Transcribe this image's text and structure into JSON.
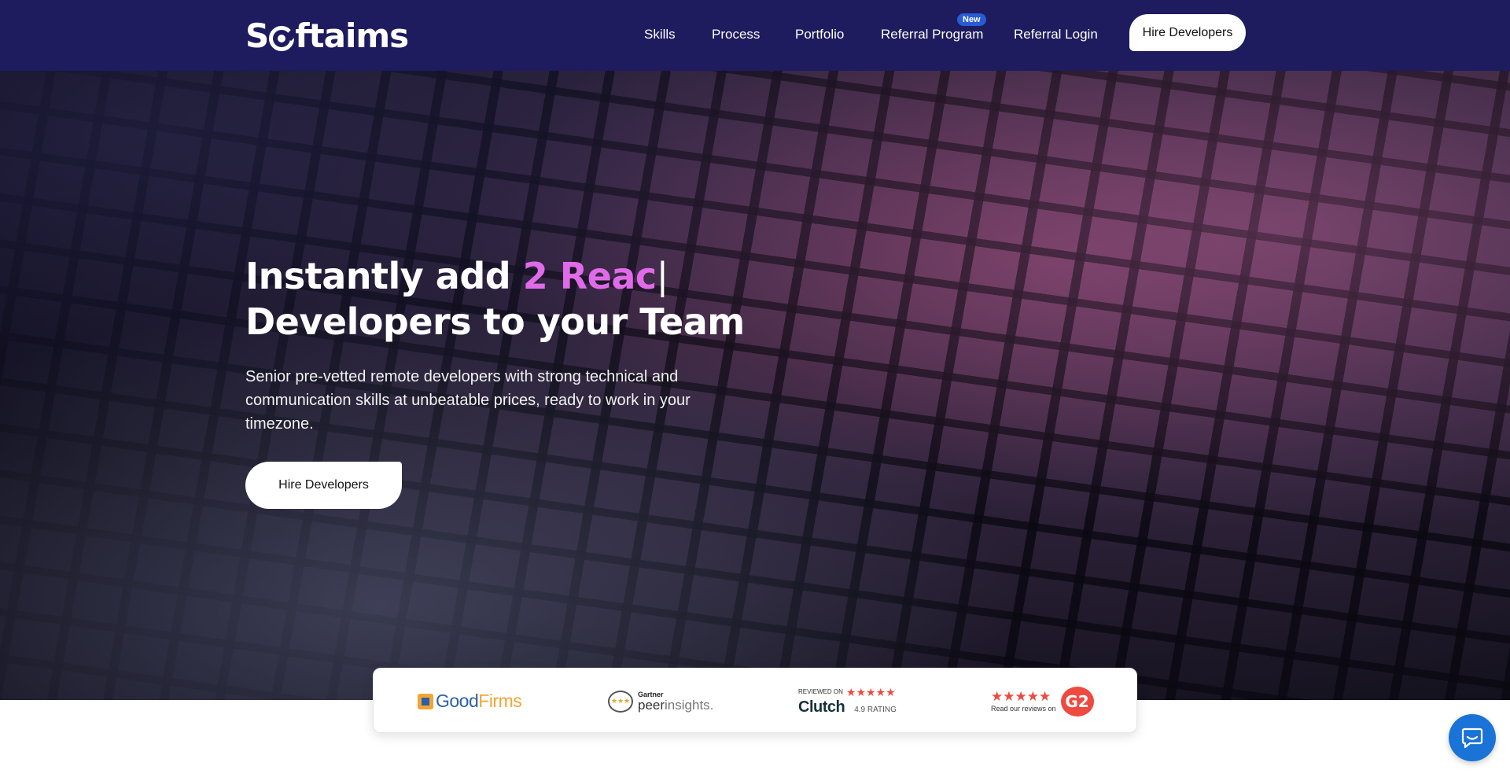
{
  "header": {
    "logo_text": "Softaims",
    "logo_pre": "S",
    "logo_post": "ftaims",
    "nav": [
      {
        "label": "Skills"
      },
      {
        "label": "Process"
      },
      {
        "label": "Portfolio"
      },
      {
        "label": "Referral Program"
      },
      {
        "label": "Referral Login"
      }
    ],
    "new_badge": "New",
    "cta_label": "Hire Developers"
  },
  "hero": {
    "headline_prefix": "Instantly add ",
    "headline_accent": "2 Reac",
    "headline_cursor": "|",
    "headline_line2": "Developers to your Team",
    "subtext": "Senior pre-vetted remote developers with strong technical and communication skills at unbeatable prices, ready to work in your timezone.",
    "cta_label": "Hire Developers"
  },
  "reviews": {
    "goodfirms": {
      "good": "Good",
      "firms": "Firms"
    },
    "gartner": {
      "small": "Gartner",
      "peer": "peer",
      "insights": "insights."
    },
    "clutch": {
      "reviewed_on": "REVIEWED ON",
      "stars": "★★★★★",
      "name": "Clutch",
      "rating": "4.9 RATING"
    },
    "g2": {
      "stars": "★★★★★",
      "note": "Read our reviews on",
      "logo": "G2"
    }
  },
  "colors": {
    "header_bg": "#1e1b5e",
    "accent": "#e06be9",
    "chat": "#1a73d6"
  },
  "icons": {
    "chat": "chat-bubble-icon"
  }
}
